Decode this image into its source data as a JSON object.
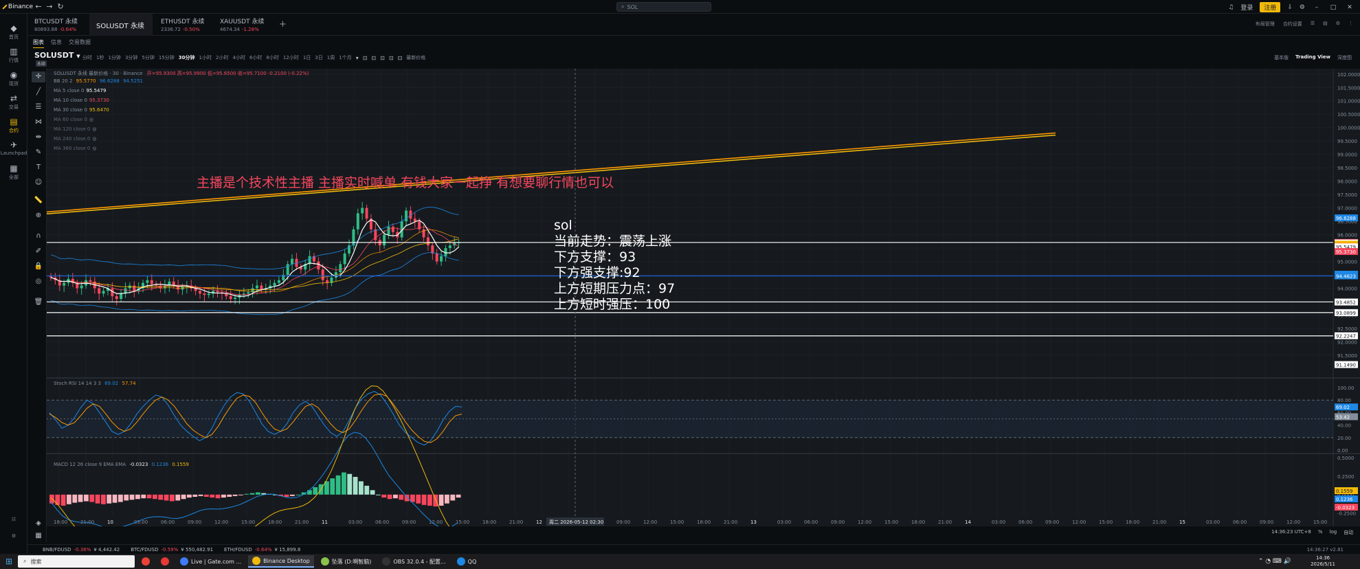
{
  "app": {
    "name": "Binance"
  },
  "top": {
    "search_placeholder": "SOL",
    "login": "登录",
    "register": "注册"
  },
  "sidebar": [
    {
      "glyph": "◆",
      "label": "首页",
      "icon": "home-icon"
    },
    {
      "glyph": "▥",
      "label": "行情",
      "icon": "market-icon"
    },
    {
      "glyph": "◉",
      "label": "现货",
      "icon": "spot-icon"
    },
    {
      "glyph": "⇄",
      "label": "交易",
      "icon": "trade-icon"
    },
    {
      "glyph": "▤",
      "label": "合约",
      "icon": "futures-icon",
      "active": true
    },
    {
      "glyph": "✈",
      "label": "Launchpad",
      "icon": "launchpad-icon"
    },
    {
      "glyph": "▦",
      "label": "全部",
      "icon": "all-icon"
    }
  ],
  "tabs": [
    {
      "title": "BTCUSDT 永续",
      "price": "80893.88",
      "change": "-0.64%"
    },
    {
      "title": "SOLUSDT 永续",
      "price": "",
      "change": "",
      "active": true
    },
    {
      "title": "ETHUSDT 永续",
      "price": "2336.72",
      "change": "-0.50%"
    },
    {
      "title": "XAUUSDT 永续",
      "price": "4674.34",
      "change": "-1.28%"
    }
  ],
  "tab_right": [
    "布局管理",
    "合约设置"
  ],
  "subtabs": [
    "图表",
    "信息",
    "交易数据"
  ],
  "symbol": {
    "name": "SOLUSDT",
    "badge": "永续"
  },
  "toolbar": {
    "intervals": [
      "分时",
      "1秒",
      "1分钟",
      "3分钟",
      "5分钟",
      "15分钟",
      "30分钟",
      "1小时",
      "2小时",
      "4小时",
      "6小时",
      "8小时",
      "12小时",
      "1日",
      "3日",
      "1周",
      "1个月"
    ],
    "active": "30分钟",
    "latest_price": "最新价格"
  },
  "view_switch": [
    "基本版",
    "Trading View",
    "深度图"
  ],
  "legend": {
    "header": "SOLUSDT 永续 最新价格 · 30 · Binance",
    "ohlc": "开=95.9300 高=95.9900 低=95.6500 收=95.7100 -0.2100 (-0.22%)",
    "bb": [
      "BB 20 2",
      "95.5770",
      "96.6288",
      "94.5251"
    ],
    "ma": [
      {
        "label": "MA 5 close 0",
        "value": "95.5479",
        "color": "#ffffff"
      },
      {
        "label": "MA 10 close 0",
        "value": "95.3730",
        "color": "#f6465d"
      },
      {
        "label": "MA 30 close 0",
        "value": "95.6470",
        "color": "#f0b90b"
      },
      {
        "label": "MA 60 close 0",
        "value": "",
        "color": "#848e9c"
      },
      {
        "label": "MA 120 close 0",
        "value": "",
        "color": "#5e6673"
      },
      {
        "label": "MA 240 close 0",
        "value": "",
        "color": "#5e6673"
      },
      {
        "label": "MA 360 close 0",
        "value": "",
        "color": "#5e6673"
      }
    ],
    "stoch": [
      "Stoch RSI 14 14 3 3",
      "69.02",
      "57.74"
    ],
    "macd": [
      "MACD 12 26 close 9 EMA EMA",
      "-0.0323",
      "0.1236",
      "0.1559"
    ]
  },
  "overlay": {
    "banner": "主播是个技术性主播 主播实时喊单 有钱大家一起挣 有想要聊行情也可以",
    "notes": [
      "sol",
      "当前走势：震荡上涨",
      "下方支撑：93",
      "下方强支撑:92",
      "上方短期压力点：97",
      "上方短时强压：100"
    ]
  },
  "chart_data": {
    "type": "candlestick",
    "symbol": "SOLUSDT",
    "interval": "30分钟",
    "ylim": [
      90.7,
      102.2
    ],
    "price_ticks": [
      "102.0000",
      "101.5000",
      "101.0000",
      "100.5000",
      "100.0000",
      "99.5000",
      "99.0000",
      "98.5000",
      "98.0000",
      "97.5000",
      "97.0000",
      "96.5000",
      "96.0000",
      "95.5000",
      "95.0000",
      "94.5000",
      "94.0000",
      "93.5000",
      "93.0000",
      "92.5000",
      "92.0000",
      "91.5000"
    ],
    "price_tags": [
      {
        "value": 96.6288,
        "label": "96.6288",
        "color": "#1e88e5"
      },
      {
        "value": 95.71,
        "label": "95.7100",
        "color": "#f6465d"
      },
      {
        "value": 95.689,
        "label": "95.6890",
        "color": "#ffffff"
      },
      {
        "value": 95.647,
        "label": "95.6470",
        "color": "#f0b90b"
      },
      {
        "value": 95.577,
        "label": "95.5770",
        "color": "#ff9800"
      },
      {
        "value": 95.5479,
        "label": "95.5479",
        "color": "#ffffff"
      },
      {
        "value": 95.373,
        "label": "95.3730",
        "color": "#f6465d"
      },
      {
        "value": 94.5251,
        "label": "94.5251",
        "color": "#1e88e5"
      },
      {
        "value": 94.4623,
        "label": "94.4623",
        "color": "#1e88e5"
      },
      {
        "value": 93.4852,
        "label": "93.4852",
        "color": "#ffffff"
      },
      {
        "value": 93.0899,
        "label": "93.0899",
        "color": "#ffffff"
      },
      {
        "value": 92.2247,
        "label": "92.2247",
        "color": "#ffffff"
      },
      {
        "value": 91.149,
        "label": "91.1490",
        "color": "#ffffff"
      }
    ],
    "horizontal_lines": [
      {
        "value": 95.71,
        "color": "#ffffff"
      },
      {
        "value": 94.46,
        "color": "#1e62d6"
      },
      {
        "value": 93.49,
        "color": "#ffffff"
      },
      {
        "value": 93.09,
        "color": "#ffffff"
      },
      {
        "value": 92.22,
        "color": "#ffffff"
      }
    ],
    "trendlines": [
      {
        "from": [
          0,
          96.85
        ],
        "to": [
          1468,
          99.8
        ],
        "color": "#ff9800"
      },
      {
        "from": [
          0,
          96.78
        ],
        "to": [
          1468,
          99.72
        ],
        "color": "#f0b90b"
      }
    ],
    "closes": [
      94.4,
      94.3,
      94.1,
      94.2,
      94.35,
      94.2,
      94.0,
      94.1,
      94.3,
      94.25,
      94.0,
      93.8,
      93.9,
      94.0,
      93.7,
      93.6,
      93.8,
      94.0,
      94.1,
      93.9,
      94.0,
      94.2,
      94.3,
      94.15,
      94.1,
      94.0,
      94.1,
      94.25,
      94.1,
      93.95,
      94.05,
      94.1,
      94.0,
      93.9,
      93.8,
      93.75,
      93.8,
      93.9,
      93.85,
      93.8,
      93.7,
      93.6,
      93.65,
      93.75,
      93.8,
      93.85,
      94.0,
      94.1,
      93.95,
      94.0,
      94.1,
      94.2,
      94.3,
      94.5,
      94.9,
      95.1,
      94.8,
      94.7,
      94.9,
      95.2,
      95.0,
      94.7,
      94.3,
      94.2,
      94.4,
      94.6,
      94.9,
      95.3,
      95.6,
      96.2,
      96.8,
      97.0,
      96.6,
      96.2,
      95.8,
      95.6,
      96.0,
      96.3,
      96.1,
      95.9,
      96.5,
      96.9,
      96.6,
      96.5,
      96.2,
      95.9,
      95.6,
      95.3,
      95.0,
      95.2,
      95.5,
      95.6,
      95.7,
      95.71
    ],
    "time_ticks": [
      "18:00",
      "21:00",
      "10",
      "03:00",
      "06:00",
      "09:00",
      "12:00",
      "15:00",
      "18:00",
      "21:00",
      "11",
      "03:00",
      "06:00",
      "09:00",
      "12:00",
      "15:00",
      "18:00",
      "21:00",
      "12",
      "02:30",
      "06:00",
      "09:00",
      "12:00",
      "15:00",
      "18:00",
      "21:00",
      "13",
      "03:00",
      "06:00",
      "09:00",
      "12:00",
      "15:00",
      "18:00",
      "21:00",
      "14",
      "03:00",
      "06:00",
      "09:00",
      "12:00",
      "15:00",
      "18:00",
      "21:00",
      "15",
      "03:00",
      "06:00",
      "09:00",
      "12:00",
      "15:00"
    ],
    "crosshair_date": "周二 2026-05-12",
    "crosshair_time": "02:30",
    "stoch_ylim": [
      0,
      100
    ],
    "stoch_ticks": [
      "100.00",
      "80.00",
      "60.00",
      "40.00",
      "20.00",
      "0.00"
    ],
    "stoch_levels": [
      80,
      20
    ],
    "stoch_k": [
      60,
      48,
      35,
      40,
      52,
      68,
      80,
      74,
      60,
      45,
      30,
      25,
      30,
      42,
      58,
      70,
      80,
      88,
      85,
      72,
      55,
      40,
      30,
      22,
      15,
      20,
      35,
      55,
      72,
      85,
      92,
      90,
      78,
      60,
      42,
      30,
      25,
      30,
      42,
      60,
      72,
      78,
      70,
      55,
      40,
      28,
      22,
      30,
      48,
      68,
      82,
      90,
      94,
      88,
      74,
      58,
      40,
      28,
      20,
      12,
      8,
      15,
      30,
      48,
      62,
      70,
      69
    ],
    "stoch_d": [
      58,
      52,
      44,
      40,
      44,
      55,
      67,
      74,
      70,
      58,
      45,
      35,
      30,
      34,
      45,
      58,
      70,
      80,
      85,
      80,
      70,
      56,
      42,
      32,
      25,
      20,
      25,
      38,
      55,
      70,
      83,
      88,
      86,
      76,
      60,
      45,
      34,
      30,
      34,
      45,
      58,
      70,
      74,
      68,
      55,
      42,
      32,
      28,
      34,
      48,
      64,
      78,
      88,
      90,
      86,
      74,
      60,
      45,
      32,
      22,
      14,
      12,
      18,
      30,
      45,
      55,
      57.74
    ],
    "stoch_tags": [
      {
        "value": 69.02,
        "label": "69.02",
        "color": "#1e88e5"
      },
      {
        "value": 53.42,
        "label": "53.42",
        "color": "#848e9c"
      }
    ],
    "macd_ticks": [
      "0.5000",
      "0.2500",
      "0.0000",
      "-0.2500"
    ],
    "macd_hist": [
      -0.12,
      -0.14,
      -0.15,
      -0.13,
      -0.11,
      -0.1,
      -0.09,
      -0.1,
      -0.12,
      -0.13,
      -0.12,
      -0.11,
      -0.1,
      -0.08,
      -0.07,
      -0.06,
      -0.05,
      -0.05,
      -0.06,
      -0.07,
      -0.08,
      -0.09,
      -0.08,
      -0.06,
      -0.04,
      -0.03,
      -0.02,
      -0.03,
      -0.04,
      -0.05,
      -0.04,
      -0.03,
      -0.02,
      -0.01,
      0.01,
      0.02,
      0.03,
      0.02,
      0.01,
      0.0,
      -0.02,
      -0.03,
      -0.02,
      0.0,
      0.03,
      0.06,
      0.1,
      0.14,
      0.18,
      0.22,
      0.26,
      0.3,
      0.28,
      0.24,
      0.18,
      0.12,
      0.06,
      0.0,
      -0.04,
      -0.06,
      -0.05,
      -0.07,
      -0.09,
      -0.1,
      -0.12,
      -0.14,
      -0.15,
      -0.16,
      -0.15,
      -0.12,
      -0.08,
      -0.04
    ],
    "macd_tags": [
      {
        "value": 0.1559,
        "label": "0.1559",
        "color": "#f0b90b"
      },
      {
        "value": 0.1236,
        "label": "0.1236",
        "color": "#1e88e5"
      },
      {
        "value": -0.0323,
        "label": "-0.0323",
        "color": "#f6465d"
      }
    ]
  },
  "status": {
    "time": "14:36:23 UTC+8",
    "percent": "%",
    "log": "log",
    "auto": "自动"
  },
  "tickers": [
    {
      "pair": "BNB/FDUSD",
      "change": "-0.36%",
      "price": "¥ 4,442.42"
    },
    {
      "pair": "BTC/FDUSD",
      "change": "-0.59%",
      "price": "¥ 550,482.91"
    },
    {
      "pair": "ETH/FDUSD",
      "change": "-0.64%",
      "price": "¥ 15,899.8"
    }
  ],
  "ticker_right": "14:36:27  v2.81",
  "taskbar": {
    "search": "搜索",
    "apps": [
      {
        "label": "",
        "color": "#e94235"
      },
      {
        "label": "",
        "color": "#e53935"
      },
      {
        "label": "Live | Gate.com ...",
        "color": "#3d7bf7"
      },
      {
        "label": "Binance Desktop",
        "color": "#f0b90b",
        "active": true
      },
      {
        "label": "坠落 (D:啊智脑)",
        "color": "#8bc34a"
      },
      {
        "label": "OBS 32.0.4 - 配置...",
        "color": "#333333"
      },
      {
        "label": "QQ",
        "color": "#1e88e5"
      }
    ],
    "time": "14:36",
    "date": "2026/5/11"
  },
  "colors": {
    "up": "#2ebd85",
    "down": "#f6465d",
    "accent": "#f0b90b",
    "grid": "#1b2028",
    "bg": "#161a1e"
  }
}
